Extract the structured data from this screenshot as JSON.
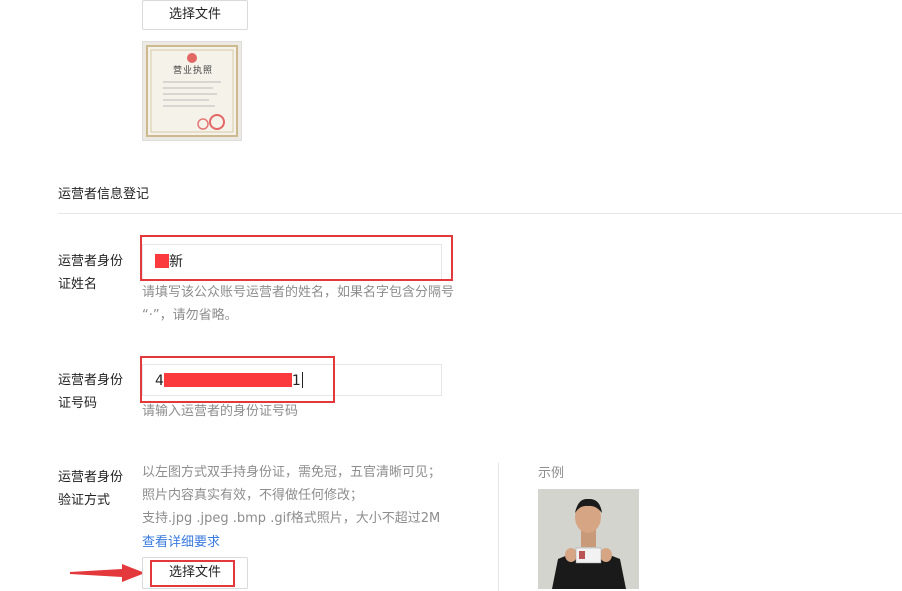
{
  "top_upload": {
    "button_label": "选择文件"
  },
  "license_thumb": {
    "title_text": "营业执照"
  },
  "section": {
    "title": "运营者信息登记"
  },
  "name_field": {
    "label_line1": "运营者身份",
    "label_line2": "证姓名",
    "value_visible": "新",
    "hint_line1": "请填写该公众账号运营者的姓名，如果名字包含分隔号",
    "hint_line2": "“·”，请勿省略。"
  },
  "id_field": {
    "label_line1": "运营者身份",
    "label_line2": "证号码",
    "value_prefix": "4",
    "value_suffix": "1",
    "hint": "请输入运营者的身份证号码"
  },
  "verify_field": {
    "label_line1": "运营者身份",
    "label_line2": "验证方式",
    "desc_line1": "以左图方式双手持身份证，需免冠，五官清晰可见；",
    "desc_line2": "照片内容真实有效，不得做任何修改；",
    "desc_line3": "支持.jpg .jpeg .bmp .gif格式照片，大小不超过2M",
    "detail_link": "查看详细要求",
    "upload_label": "选择文件",
    "example_title": "示例"
  },
  "colors": {
    "highlight": "#e4393c",
    "link": "#3a7be0",
    "hint": "#8d8d8d"
  }
}
